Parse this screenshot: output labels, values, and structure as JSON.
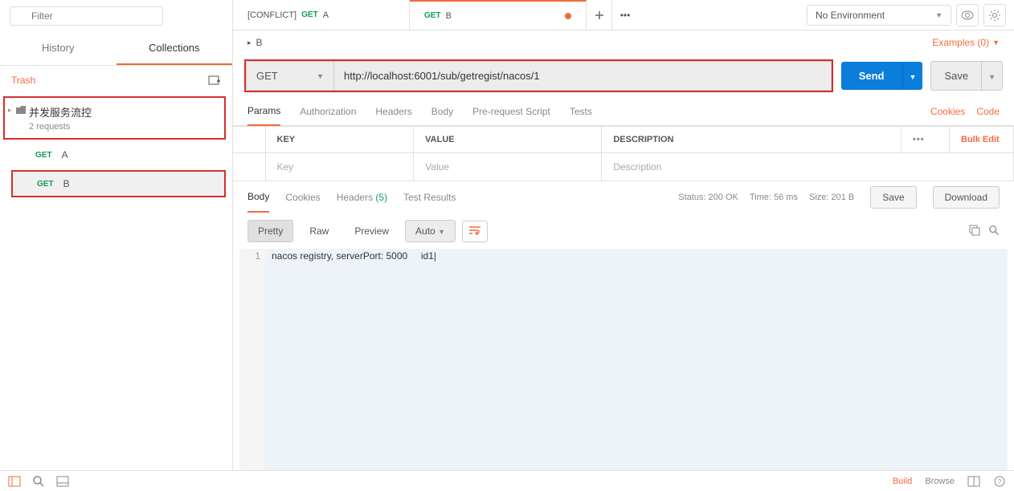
{
  "sidebar": {
    "filter_placeholder": "Filter",
    "tabs": {
      "history": "History",
      "collections": "Collections"
    },
    "trash": "Trash",
    "collection": {
      "name": "并发服务流控",
      "sub": "2 requests"
    },
    "requests": [
      {
        "method": "GET",
        "name": "A"
      },
      {
        "method": "GET",
        "name": "B"
      }
    ]
  },
  "tabs": [
    {
      "conflict": "[CONFLICT]",
      "method": "GET",
      "name": "A"
    },
    {
      "conflict": "",
      "method": "GET",
      "name": "B"
    }
  ],
  "env": "No Environment",
  "breadcrumb": "B",
  "examples": "Examples (0)",
  "method": "GET",
  "url": "http://localhost:6001/sub/getregist/nacos/1",
  "send": "Send",
  "save": "Save",
  "request_tabs": {
    "params": "Params",
    "auth": "Authorization",
    "headers": "Headers",
    "body": "Body",
    "prereq": "Pre-request Script",
    "tests": "Tests",
    "cookies": "Cookies",
    "code": "Code"
  },
  "param_headers": {
    "key": "KEY",
    "value": "VALUE",
    "desc": "DESCRIPTION"
  },
  "param_placeholders": {
    "key": "Key",
    "value": "Value",
    "desc": "Description"
  },
  "bulk_edit": "Bulk Edit",
  "response_tabs": {
    "body": "Body",
    "cookies": "Cookies",
    "headers": "Headers",
    "headers_count": "(5)",
    "tests": "Test Results"
  },
  "status": {
    "label": "Status:",
    "value": "200 OK"
  },
  "time": {
    "label": "Time:",
    "value": "56 ms"
  },
  "size": {
    "label": "Size:",
    "value": "201 B"
  },
  "resp_save": "Save",
  "resp_download": "Download",
  "view": {
    "pretty": "Pretty",
    "raw": "Raw",
    "preview": "Preview",
    "auto": "Auto"
  },
  "line_num": "1",
  "response_body": "nacos registry, serverPort: 5000     id1",
  "footer": {
    "build": "Build",
    "browse": "Browse"
  }
}
